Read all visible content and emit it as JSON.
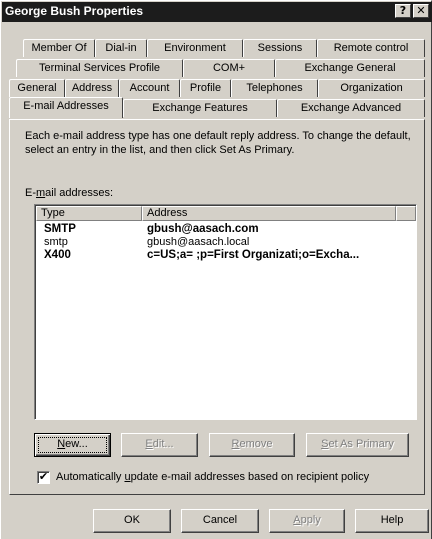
{
  "window": {
    "title": "George Bush Properties",
    "help_glyph": "?",
    "close_glyph": "✕"
  },
  "tabs": {
    "row1": [
      "Member Of",
      "Dial-in",
      "Environment",
      "Sessions",
      "Remote control"
    ],
    "row2": [
      "Terminal Services Profile",
      "COM+",
      "Exchange General"
    ],
    "row3": [
      "General",
      "Address",
      "Account",
      "Profile",
      "Telephones",
      "Organization"
    ],
    "row4": [
      "E-mail Addresses",
      "Exchange Features",
      "Exchange Advanced"
    ],
    "active": "E-mail Addresses"
  },
  "content": {
    "description": "Each e-mail address type has one default reply address. To change the default, select an entry in the list, and then click Set As Primary.",
    "list_label_pre": "E-",
    "list_label_mnemonic": "m",
    "list_label_post": "ail addresses:",
    "columns": [
      "Type",
      "Address"
    ],
    "rows": [
      {
        "type": "SMTP",
        "address": "gbush@aasach.com",
        "primary": true
      },
      {
        "type": "smtp",
        "address": "gbush@aasach.local",
        "primary": false
      },
      {
        "type": "X400",
        "address": "c=US;a= ;p=First Organizati;o=Excha...",
        "primary": true
      }
    ]
  },
  "buttons": {
    "new_mn": "N",
    "new_rest": "ew...",
    "edit_mn": "E",
    "edit_rest": "dit...",
    "remove_mn": "R",
    "remove_rest": "emove",
    "primary_mn": "S",
    "primary_rest": "et As Primary"
  },
  "checkbox": {
    "checked": true,
    "mark": "✔",
    "label_pre": "Automatically ",
    "label_mn": "u",
    "label_post": "pdate e-mail addresses based on recipient policy"
  },
  "footer": {
    "ok": "OK",
    "cancel": "Cancel",
    "apply_mn": "A",
    "apply_rest": "pply",
    "help": "Help"
  }
}
